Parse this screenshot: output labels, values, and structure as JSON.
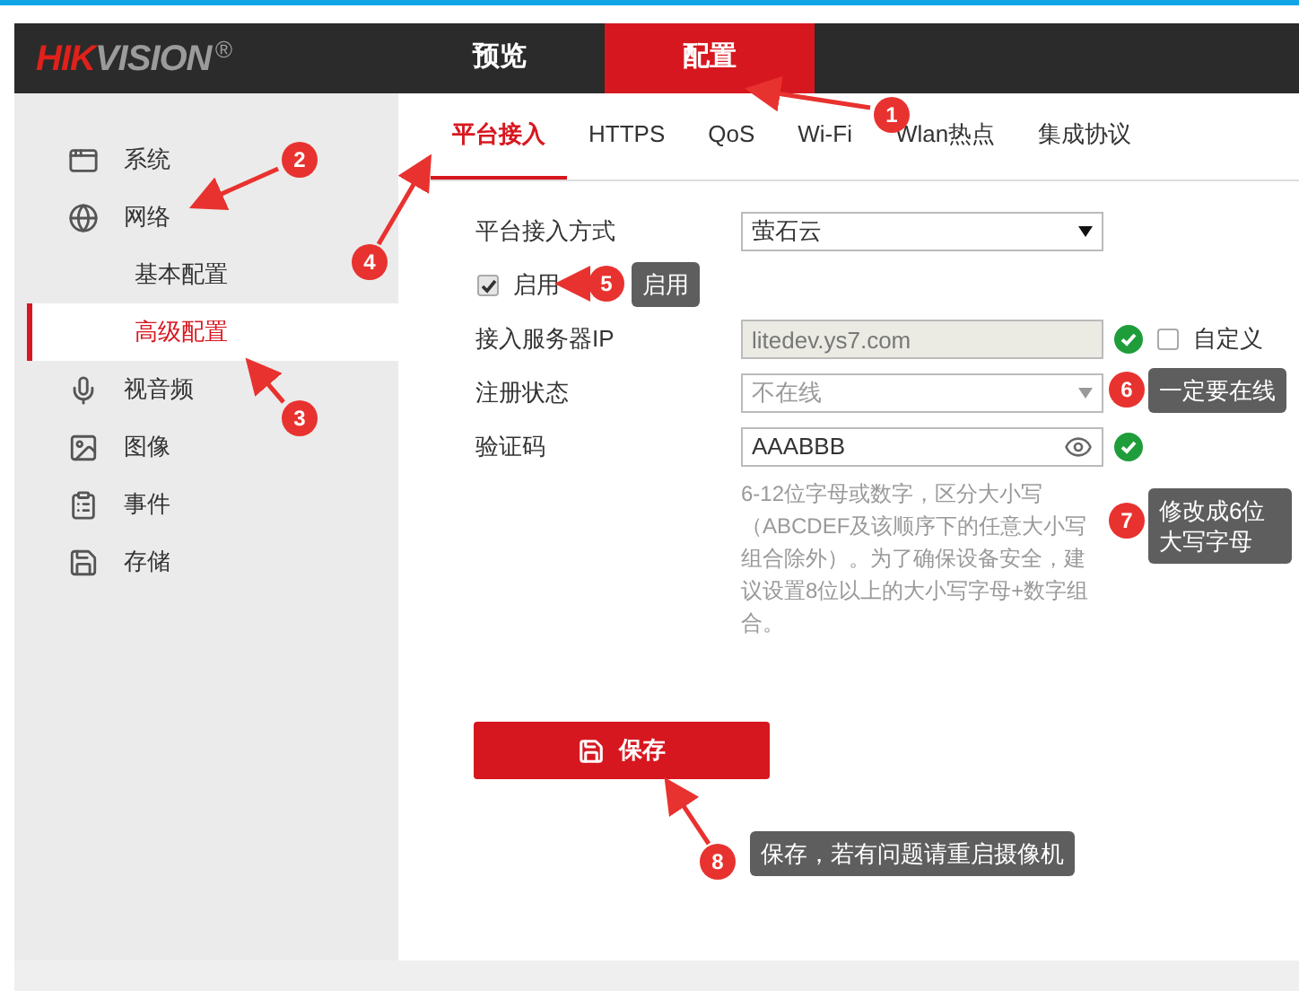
{
  "header": {
    "logo": {
      "part_1": "HIK",
      "part_2": "VISION",
      "symbol": "®"
    },
    "nav": [
      {
        "label": "预览",
        "selected": false
      },
      {
        "label": "配置",
        "selected": true
      }
    ]
  },
  "sidebar": {
    "items": [
      {
        "label": "系统",
        "selected": false
      },
      {
        "label": "网络",
        "selected": false,
        "children": [
          {
            "label": "基本配置",
            "selected": false
          },
          {
            "label": "高级配置",
            "selected": true
          }
        ]
      },
      {
        "label": "视音频",
        "selected": false
      },
      {
        "label": "图像",
        "selected": false
      },
      {
        "label": "事件",
        "selected": false
      },
      {
        "label": "存储",
        "selected": false
      }
    ]
  },
  "tabs": [
    {
      "label": "平台接入",
      "selected": true
    },
    {
      "label": "HTTPS",
      "selected": false
    },
    {
      "label": "QoS",
      "selected": false
    },
    {
      "label": "Wi-Fi",
      "selected": false
    },
    {
      "label": "Wlan热点",
      "selected": false
    },
    {
      "label": "集成协议",
      "selected": false
    }
  ],
  "form": {
    "access_mode": {
      "label": "平台接入方式",
      "value": "萤石云"
    },
    "enable": {
      "label": "启用",
      "checked": true
    },
    "server_ip": {
      "label": "接入服务器IP",
      "value": "litedev.ys7.com",
      "verified": true,
      "disabled": true,
      "custom": {
        "label": "自定义",
        "checked": false
      }
    },
    "status": {
      "label": "注册状态",
      "value": "不在线",
      "disabled": true
    },
    "code": {
      "label": "验证码",
      "value": "AAABBB",
      "verified": true,
      "hint": "6-12位字母或数字，区分大小写（ABCDEF及该顺序下的任意大小写组合除外）。为了确保设备安全，建议设置8位以上的大小写字母+数字组合。"
    },
    "save": {
      "label": "保存"
    }
  },
  "annotations": [
    {
      "number": "1"
    },
    {
      "number": "2"
    },
    {
      "number": "3"
    },
    {
      "number": "4"
    },
    {
      "number": "5",
      "text": "启用"
    },
    {
      "number": "6",
      "text": "一定要在线"
    },
    {
      "number": "7",
      "text": "修改成6位大写字母"
    },
    {
      "number": "8",
      "text": "保存，若有问题请重启摄像机"
    }
  ]
}
